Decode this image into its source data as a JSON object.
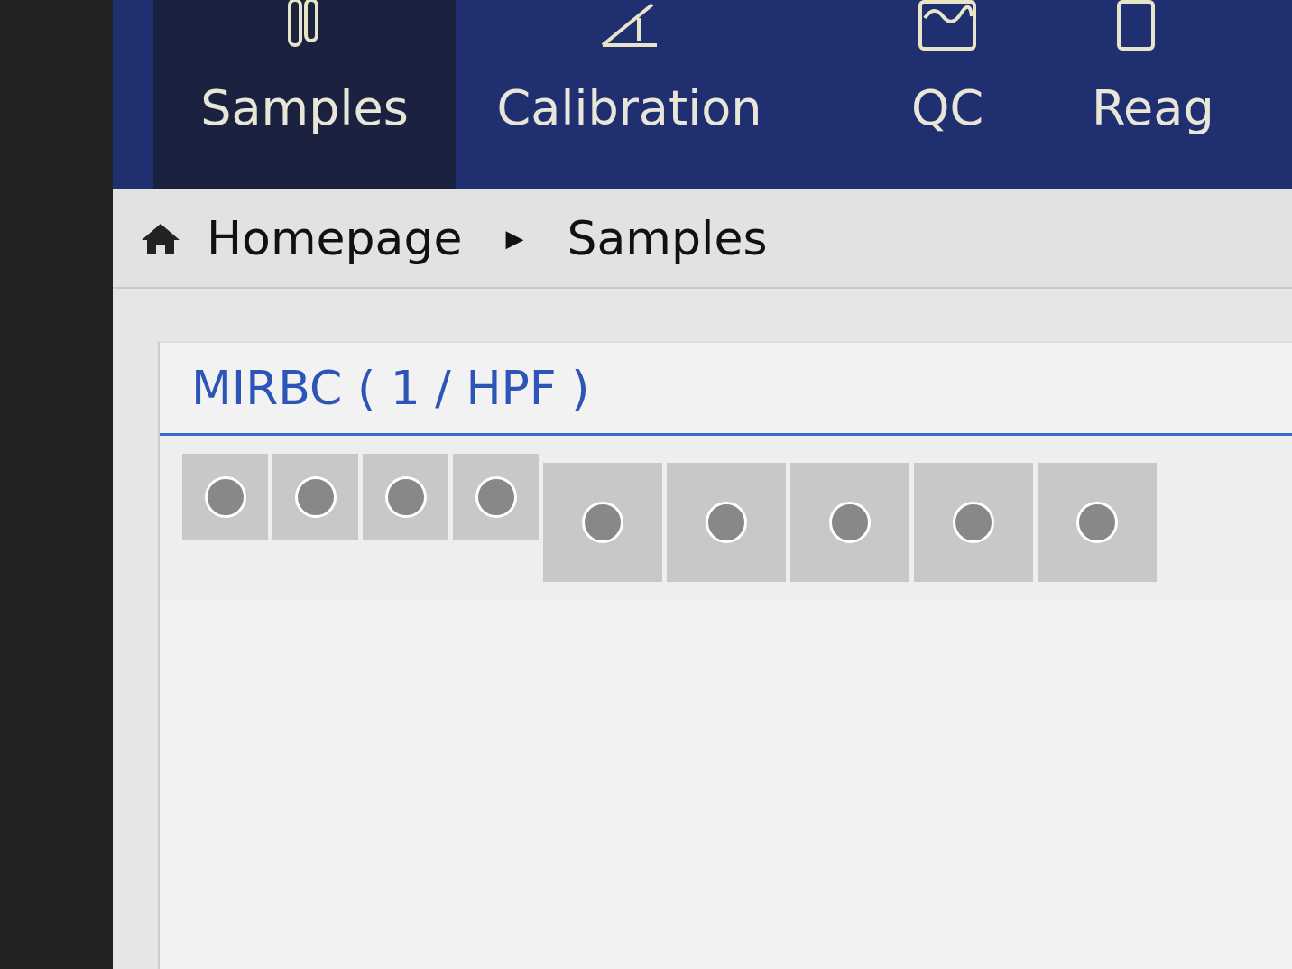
{
  "nav": {
    "tabs": [
      {
        "label": "Samples",
        "selected": true,
        "kind": "tubes"
      },
      {
        "label": "Calibration",
        "selected": false,
        "kind": "ruler"
      },
      {
        "label": "QC",
        "selected": false,
        "kind": "chart"
      },
      {
        "label": "Reag",
        "selected": false,
        "kind": "box"
      }
    ]
  },
  "breadcrumb": {
    "items": [
      "Homepage",
      "Samples"
    ],
    "separator": "▶"
  },
  "panel": {
    "title": "MIRBC ( 1 / HPF )",
    "images": [
      {
        "kind": "small"
      },
      {
        "kind": "small"
      },
      {
        "kind": "small"
      },
      {
        "kind": "small"
      },
      {
        "kind": "large"
      },
      {
        "kind": "large"
      },
      {
        "kind": "large"
      },
      {
        "kind": "large"
      },
      {
        "kind": "large"
      }
    ]
  }
}
